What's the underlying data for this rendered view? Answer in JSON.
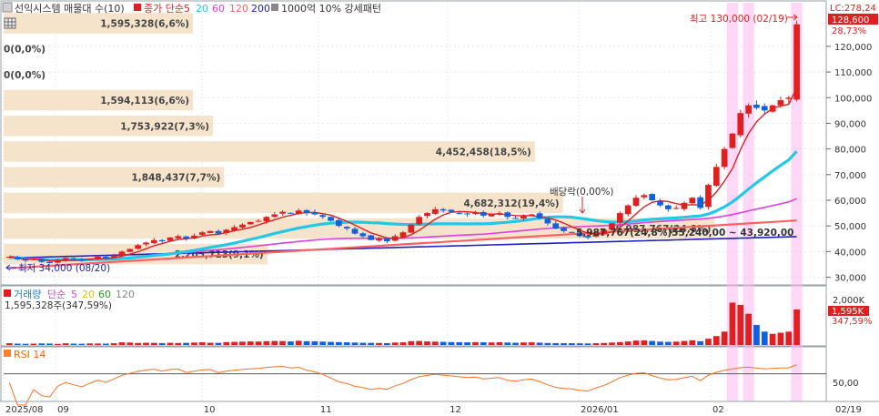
{
  "header": {
    "title": "선익시스템 매물대 수(10)",
    "ma_label": "종가 단순",
    "ma_periods": [
      "5",
      "20",
      "60",
      "120",
      "200"
    ],
    "ma_colors": [
      "#e02020",
      "#22c8e8",
      "#e040e0",
      "#ff6060",
      "#2020c0"
    ],
    "pattern": "1000억 10% 강세패턴"
  },
  "price_panel": {
    "lc": "LC:278,24",
    "current": "128,600",
    "change_pct": "28,73%",
    "high_label": "최고 130,000 (02/19)",
    "low_label": "최저 34,000 (08/20)",
    "dividend_label": "배당락(0,00%)",
    "range_label": "5,987,767(24,8%)55,240,00 ~ 43,920,00",
    "y_ticks": [
      "120,000",
      "110,000",
      "100,000",
      "90,000",
      "80,000",
      "70,000",
      "60,000",
      "50,000",
      "40,000",
      "30,000"
    ],
    "y_values": [
      120000,
      110000,
      100000,
      90000,
      80000,
      70000,
      60000,
      50000,
      40000,
      30000
    ]
  },
  "volume_profile": [
    {
      "label": "1,595,328(6,6%)",
      "low": 125000,
      "high": 133000,
      "frac": 0.237
    },
    {
      "label": "0(0,0%)",
      "low": 115000,
      "high": 123000,
      "frac": 0.0
    },
    {
      "label": "0(0,0%)",
      "low": 105000,
      "high": 113000,
      "frac": 0.0
    },
    {
      "label": "1,594,113(6,6%)",
      "low": 95000,
      "high": 103000,
      "frac": 0.237
    },
    {
      "label": "1,753,922(7,3%)",
      "low": 85000,
      "high": 93000,
      "frac": 0.262
    },
    {
      "label": "4,452,458(18,5%)",
      "low": 75000,
      "high": 83000,
      "frac": 0.665
    },
    {
      "label": "1,848,437(7,7%)",
      "low": 65000,
      "high": 73000,
      "frac": 0.276
    },
    {
      "label": "4,682,312(19,4%)",
      "low": 55000,
      "high": 63000,
      "frac": 0.7
    },
    {
      "label": "5,987,767(24,8%)",
      "low": 45000,
      "high": 53000,
      "frac": 0.89
    },
    {
      "label": "2,205,713(9,1%)",
      "low": 35000,
      "high": 43000,
      "frac": 0.33
    }
  ],
  "volume_panel": {
    "title": "거래량",
    "ma_label": "단순",
    "ma_periods": [
      "5",
      "20",
      "60",
      "120"
    ],
    "value_label": "1,595,328주(347,59%)",
    "y_tick": "2,000K",
    "current": "1,595K",
    "current_pct": "347,59%"
  },
  "rsi_panel": {
    "title": "RSI 14",
    "y_tick": "50,00"
  },
  "x_axis": {
    "labels": [
      "2025/08",
      "09",
      "10",
      "11",
      "12",
      "2026/01",
      "02",
      "02/19"
    ]
  },
  "chart_data": {
    "type": "candlestick",
    "title": "선익시스템 매물대 수(10)",
    "y_range": [
      27000,
      137000
    ],
    "high": 130000,
    "low": 34000,
    "last_close": 128600,
    "ohlc_anchors_dates": [
      "2025/08",
      "09",
      "10",
      "11",
      "12",
      "2026/01",
      "02",
      "02/19"
    ],
    "close_path": [
      38000,
      37000,
      36500,
      37200,
      36000,
      35500,
      36800,
      37500,
      37000,
      36500,
      37200,
      38000,
      37500,
      38500,
      40000,
      41000,
      42500,
      43500,
      44500,
      44000,
      45500,
      46000,
      45000,
      46200,
      47500,
      48000,
      47000,
      48500,
      49500,
      50500,
      51500,
      52000,
      53500,
      54500,
      55500,
      55000,
      56000,
      55000,
      54500,
      53500,
      52000,
      50000,
      49000,
      47000,
      46000,
      44500,
      45000,
      44000,
      46000,
      47500,
      50500,
      53500,
      55000,
      56500,
      56000,
      55500,
      55000,
      54500,
      55000,
      54000,
      54500,
      55000,
      53500,
      53000,
      54000,
      54500,
      53000,
      51000,
      49000,
      48000,
      47500,
      46000,
      45500,
      47000,
      48500,
      51000,
      55000,
      58000,
      61000,
      62000,
      60000,
      58000,
      56500,
      57000,
      59000,
      61000,
      57000,
      66000,
      73000,
      80000,
      86000,
      94000,
      97000,
      96000,
      95000,
      97000,
      99000,
      100000,
      128600
    ],
    "volume_values": [
      80,
      60,
      55,
      60,
      70,
      65,
      50,
      75,
      60,
      55,
      70,
      65,
      60,
      80,
      120,
      110,
      90,
      100,
      95,
      85,
      100,
      90,
      95,
      110,
      120,
      100,
      95,
      130,
      140,
      150,
      160,
      155,
      170,
      180,
      175,
      160,
      190,
      170,
      165,
      150,
      140,
      130,
      120,
      110,
      100,
      95,
      90,
      85,
      110,
      120,
      170,
      180,
      160,
      150,
      140,
      130,
      125,
      120,
      130,
      120,
      115,
      125,
      110,
      100,
      115,
      120,
      105,
      90,
      85,
      80,
      80,
      75,
      70,
      80,
      90,
      110,
      130,
      160,
      200,
      210,
      180,
      150,
      140,
      150,
      180,
      210,
      170,
      280,
      400,
      600,
      1900,
      1800,
      1400,
      900,
      600,
      500,
      550,
      600,
      1595
    ]
  }
}
